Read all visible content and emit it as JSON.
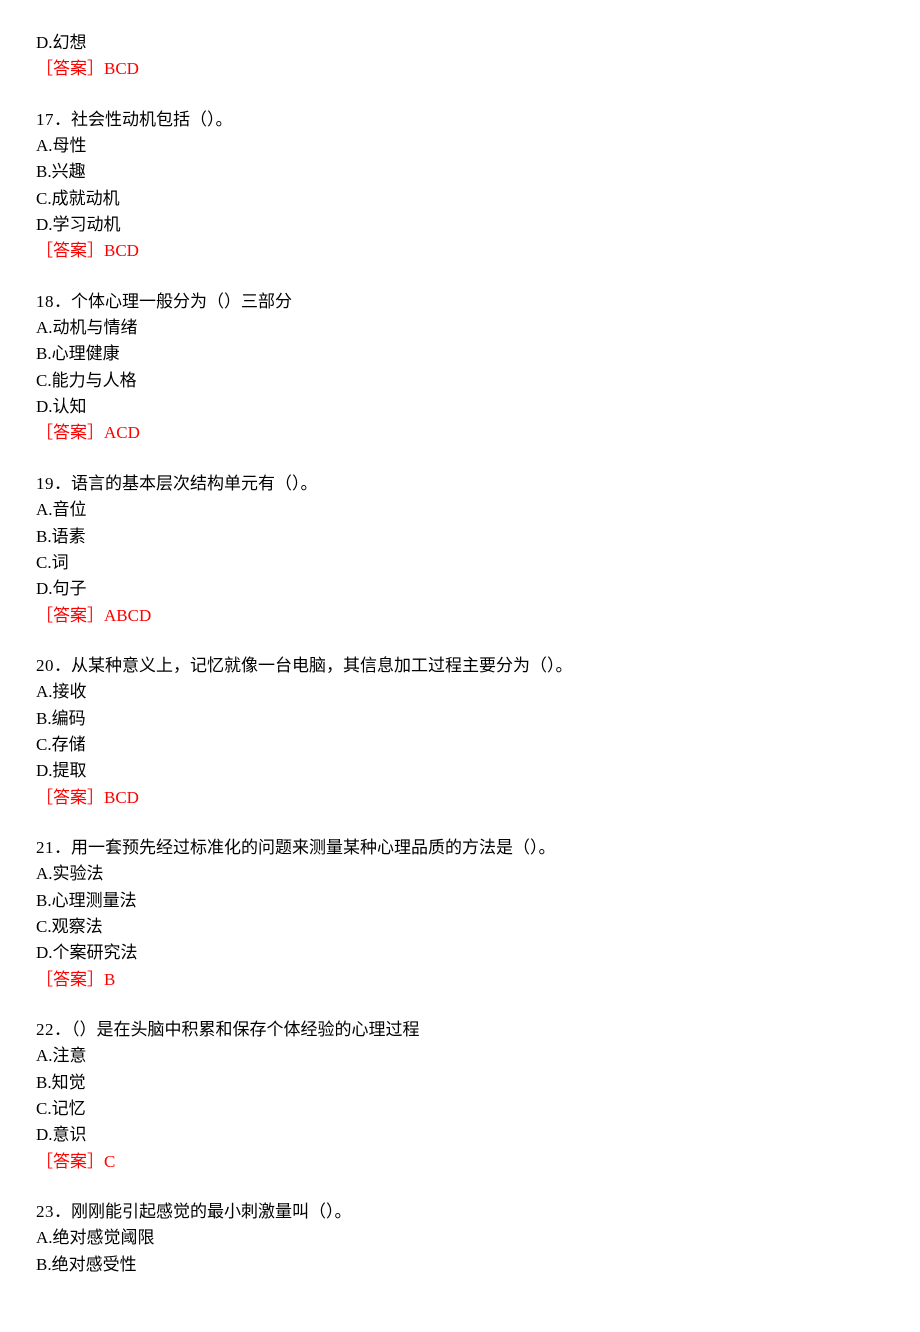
{
  "fragments": {
    "top": {
      "optionD": "D.幻想",
      "answerLabel": "［答案］",
      "answerValue": "BCD"
    }
  },
  "questions": [
    {
      "number": "17",
      "stem": "．社会性动机包括（）。",
      "options": [
        "A.母性",
        "B.兴趣",
        "C.成就动机",
        "D.学习动机"
      ],
      "answerLabel": "［答案］",
      "answerValue": "BCD"
    },
    {
      "number": "18",
      "stem": "．个体心理一般分为（）三部分",
      "options": [
        "A.动机与情绪",
        "B.心理健康",
        "C.能力与人格",
        "D.认知"
      ],
      "answerLabel": "［答案］",
      "answerValue": "ACD"
    },
    {
      "number": "19",
      "stem": "．语言的基本层次结构单元有（）。",
      "options": [
        "A.音位",
        "B.语素",
        "C.词",
        "D.句子"
      ],
      "answerLabel": "［答案］",
      "answerValue": "ABCD"
    },
    {
      "number": "20",
      "stem": "．从某种意义上，记忆就像一台电脑，其信息加工过程主要分为（）。",
      "options": [
        "A.接收",
        "B.编码",
        "C.存储",
        "D.提取"
      ],
      "answerLabel": "［答案］",
      "answerValue": "BCD"
    },
    {
      "number": "21",
      "stem": "．用一套预先经过标准化的问题来测量某种心理品质的方法是（）。",
      "options": [
        "A.实验法",
        "B.心理测量法",
        "C.观察法",
        "D.个案研究法"
      ],
      "answerLabel": "［答案］",
      "answerValue": "B"
    },
    {
      "number": "22",
      "stem": "．（）是在头脑中积累和保存个体经验的心理过程",
      "options": [
        "A.注意",
        "B.知觉",
        "C.记忆",
        "D.意识"
      ],
      "answerLabel": "［答案］",
      "answerValue": "C"
    },
    {
      "number": "23",
      "stem": "．刚刚能引起感觉的最小刺激量叫（）。",
      "options": [
        "A.绝对感觉阈限",
        "B.绝对感受性"
      ],
      "answerLabel": "",
      "answerValue": ""
    }
  ]
}
